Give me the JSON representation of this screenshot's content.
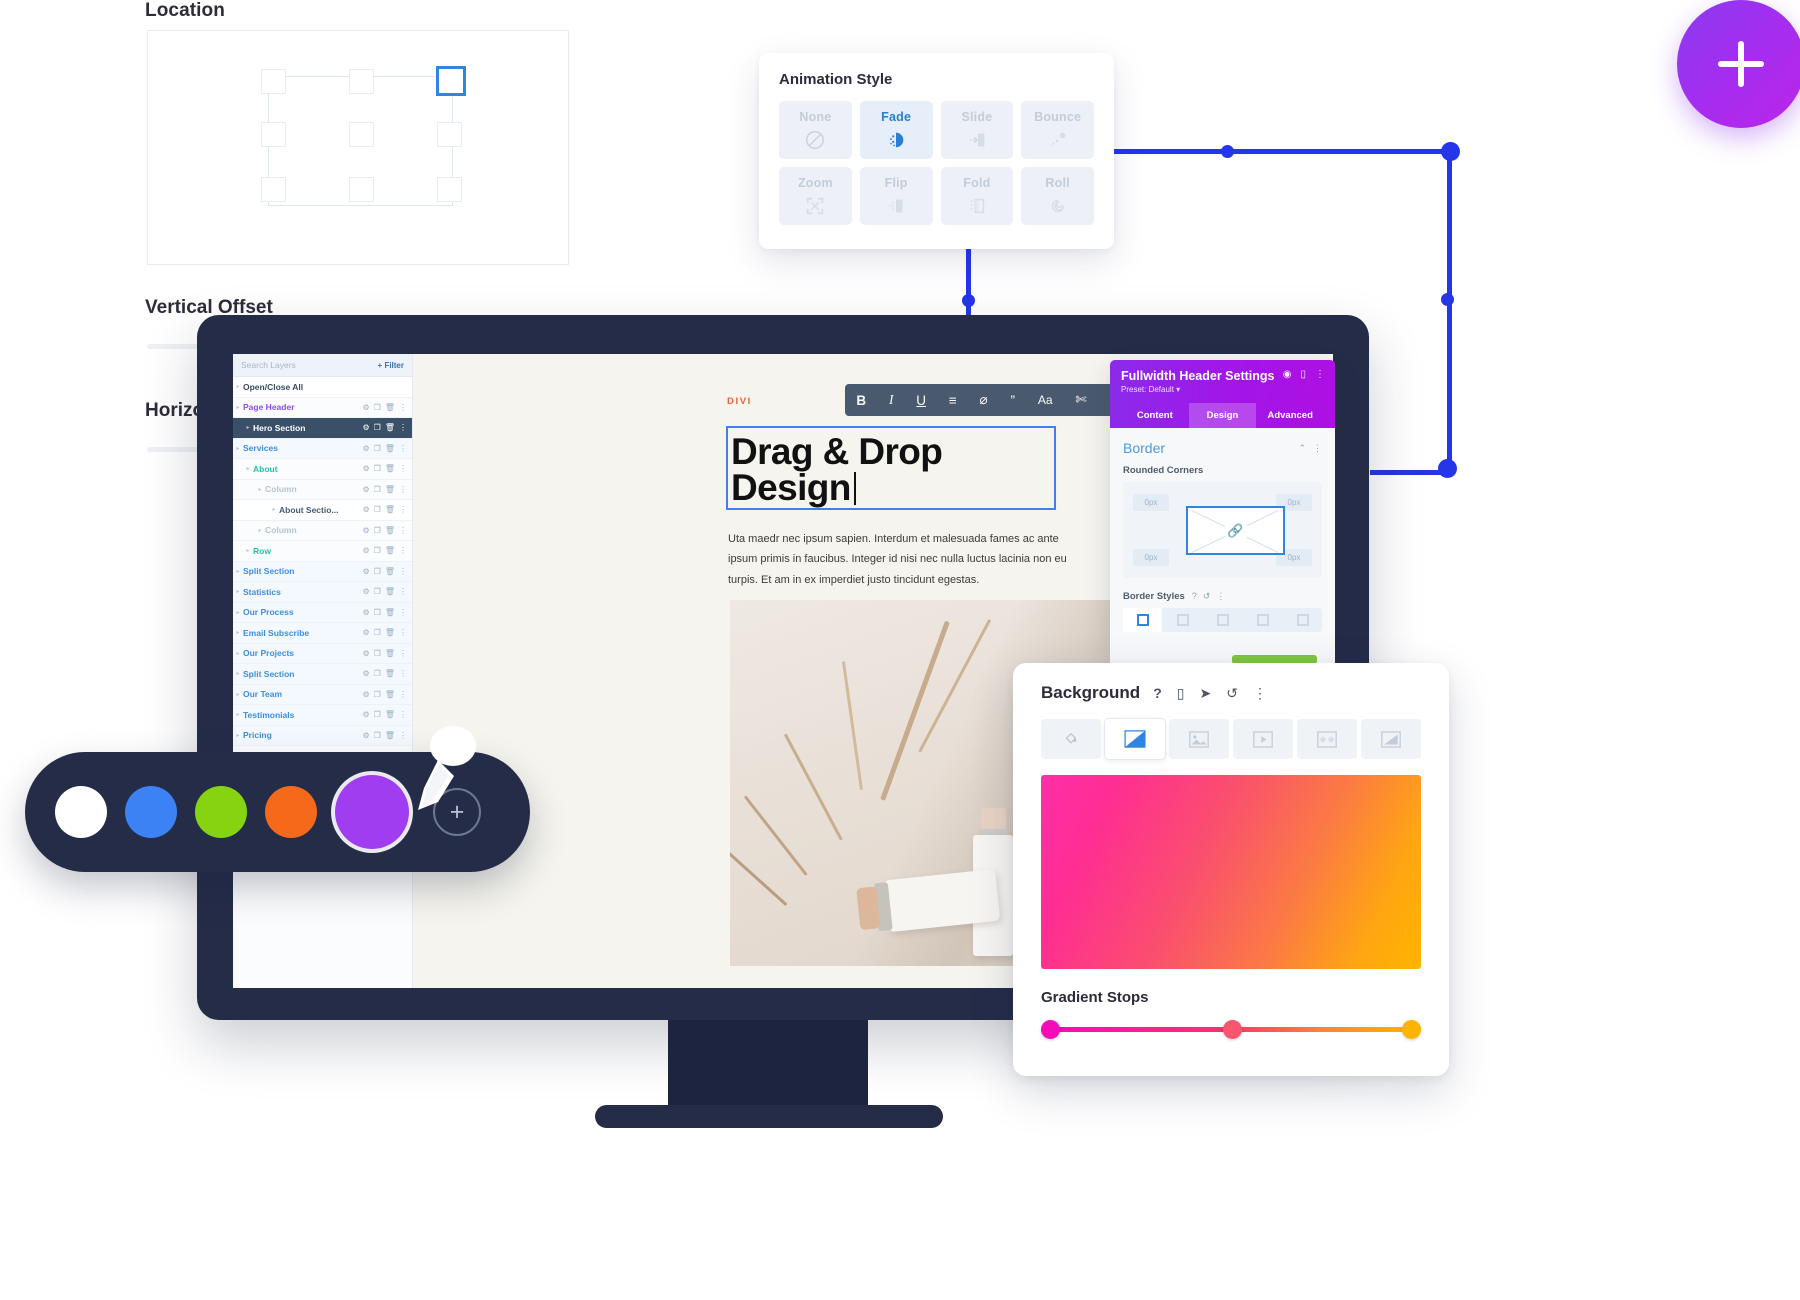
{
  "left_settings": {
    "location_label": "Location",
    "vertical_offset_label": "Vertical Offset",
    "horizontal_offset_label": "Horizontal Offset",
    "selected_cell": "top-right"
  },
  "animation_card": {
    "title": "Animation Style",
    "selected": "Fade",
    "options": [
      {
        "label": "None",
        "icon": "no-entry-icon",
        "selected": false
      },
      {
        "label": "Fade",
        "icon": "fade-icon",
        "selected": true
      },
      {
        "label": "Slide",
        "icon": "slide-icon",
        "selected": false
      },
      {
        "label": "Bounce",
        "icon": "bounce-icon",
        "selected": false
      },
      {
        "label": "Zoom",
        "icon": "zoom-icon",
        "selected": false
      },
      {
        "label": "Flip",
        "icon": "flip-icon",
        "selected": false
      },
      {
        "label": "Fold",
        "icon": "fold-icon",
        "selected": false
      },
      {
        "label": "Roll",
        "icon": "roll-icon",
        "selected": false
      }
    ]
  },
  "layers_panel": {
    "search_placeholder": "Search Layers",
    "filter_label": "Filter",
    "open_close_all": "Open/Close All",
    "rows": [
      {
        "label": "Page Header",
        "style": "purple",
        "indent": 0
      },
      {
        "label": "Hero Section",
        "style": "dark",
        "indent": 1
      },
      {
        "label": "Services",
        "style": "lv-sec",
        "indent": 0
      },
      {
        "label": "About",
        "style": "green",
        "indent": 1
      },
      {
        "label": "Column",
        "style": "grey",
        "indent": 2
      },
      {
        "label": "About Sectio...",
        "style": "plain",
        "indent": 3
      },
      {
        "label": "Column",
        "style": "grey",
        "indent": 2
      },
      {
        "label": "Row",
        "style": "green",
        "indent": 1
      },
      {
        "label": "Split Section",
        "style": "lv-sec",
        "indent": 0
      },
      {
        "label": "Statistics",
        "style": "lv-sec",
        "indent": 0
      },
      {
        "label": "Our Process",
        "style": "lv-sec",
        "indent": 0
      },
      {
        "label": "Email Subscribe",
        "style": "lv-sec",
        "indent": 0
      },
      {
        "label": "Our Projects",
        "style": "lv-sec",
        "indent": 0
      },
      {
        "label": "Split Section",
        "style": "lv-sec",
        "indent": 0
      },
      {
        "label": "Our Team",
        "style": "lv-sec",
        "indent": 0
      },
      {
        "label": "Testimonials",
        "style": "lv-sec",
        "indent": 0
      },
      {
        "label": "Pricing",
        "style": "lv-sec",
        "indent": 0
      }
    ]
  },
  "canvas": {
    "brand_tag": "DIVI",
    "toolbar_icons": [
      "bold-icon",
      "italic-icon",
      "underline-icon",
      "align-left-icon",
      "link-off-icon",
      "quote-icon",
      "text-size-icon",
      "clear-format-icon",
      "list-icon"
    ],
    "toolbar_labels": [
      "B",
      "I",
      "U",
      "≡",
      "⌀",
      "”",
      "Aa",
      "✂",
      "☰"
    ],
    "headline": "Drag & Drop Design",
    "paragraph": "Uta maedr nec ipsum sapien. Interdum et malesuada fames ac ante ipsum primis in faucibus. Integer id nisi nec nulla luctus lacinia non eu turpis. Et am in ex imperdiet justo tincidunt egestas."
  },
  "header_settings": {
    "title": "Fullwidth Header Settings",
    "preset": "Preset: Default",
    "header_icons": [
      "target-icon",
      "layout-icon",
      "kebab-menu-icon"
    ],
    "tabs": [
      {
        "label": "Content",
        "active": false
      },
      {
        "label": "Design",
        "active": true
      },
      {
        "label": "Advanced",
        "active": false
      }
    ],
    "section_title": "Border",
    "section_icons": [
      "chevron-up-icon",
      "kebab-menu-icon"
    ],
    "rounded_corners_label": "Rounded Corners",
    "corner_values": [
      "0px",
      "0px",
      "0px",
      "0px"
    ],
    "link_icon": "link-icon",
    "border_styles_label": "Border Styles",
    "border_styles_icons": [
      "help-icon",
      "reset-icon",
      "kebab-menu-icon"
    ],
    "border_style_tabs": [
      "all-borders-icon",
      "top-border-icon",
      "right-border-icon",
      "bottom-border-icon",
      "left-border-icon"
    ],
    "border_style_selected_index": 0
  },
  "background_card": {
    "title": "Background",
    "header_icons": [
      "help-icon",
      "mobile-icon",
      "cursor-icon",
      "reset-icon",
      "kebab-menu-icon"
    ],
    "types": [
      {
        "icon": "paint-bucket-icon",
        "selected": false
      },
      {
        "icon": "gradient-icon",
        "selected": true
      },
      {
        "icon": "image-icon",
        "selected": false
      },
      {
        "icon": "video-icon",
        "selected": false
      },
      {
        "icon": "pattern-icon",
        "selected": false
      },
      {
        "icon": "mask-icon",
        "selected": false
      }
    ],
    "gradient_stops_label": "Gradient Stops",
    "stops": [
      {
        "position": 0,
        "color": "#f50cb8"
      },
      {
        "position": 50,
        "color": "#f7566e"
      },
      {
        "position": 100,
        "color": "#ffb400"
      }
    ],
    "preview_gradient_colors": [
      "#ff2fa8",
      "#fa4f6e",
      "#fb7a44",
      "#ffa611"
    ]
  },
  "color_picker": {
    "swatches": [
      {
        "color": "#ffffff",
        "selected": false
      },
      {
        "color": "#3d82f5",
        "selected": false
      },
      {
        "color": "#86d411",
        "selected": false
      },
      {
        "color": "#f5691a",
        "selected": false
      },
      {
        "color": "#a13df0",
        "selected": true
      }
    ],
    "add_label": "+",
    "eyedropper_icon": "eyedropper-icon"
  },
  "fab": {
    "icon": "plus-icon",
    "color": "#a32ef0"
  },
  "accent_colors": {
    "blue_connector": "#2436e8",
    "divi_purple": "#a315e8",
    "monitor_navy": "#252c48"
  }
}
